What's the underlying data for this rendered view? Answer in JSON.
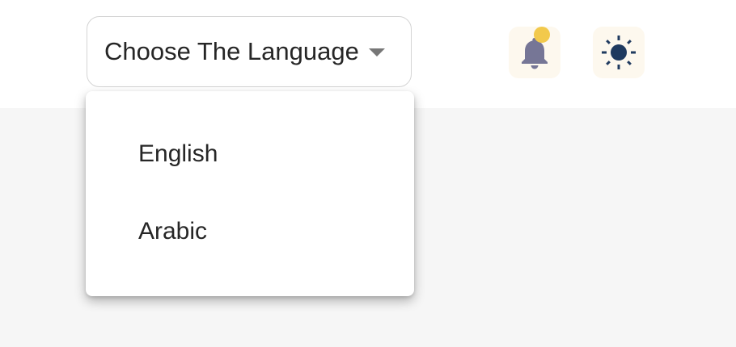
{
  "header": {
    "language_select": {
      "label": "Choose The Language",
      "icon": "caret-down-icon"
    },
    "notifications": {
      "icon": "bell-icon",
      "has_unread": true,
      "badge_color": "#f2c94c",
      "icon_color": "#767696"
    },
    "theme_toggle": {
      "icon": "sun-icon",
      "icon_color": "#1f3a5f"
    }
  },
  "language_dropdown": {
    "open": true,
    "options": [
      {
        "label": "English"
      },
      {
        "label": "Arabic"
      }
    ]
  }
}
